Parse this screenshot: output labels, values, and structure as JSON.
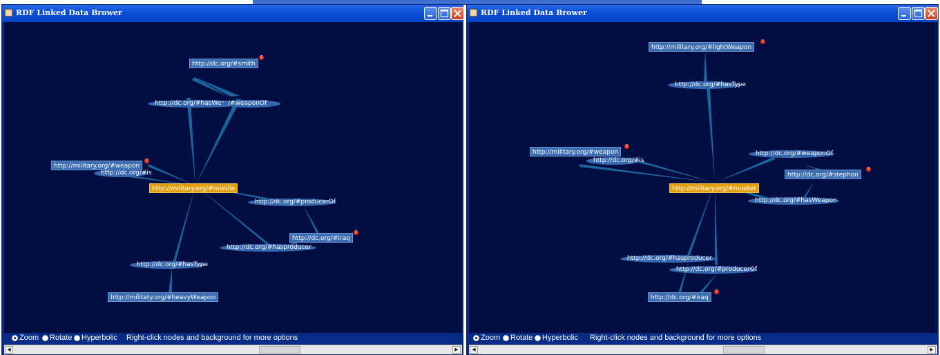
{
  "windows": [
    {
      "title": "RDF Linked Data Brower",
      "nodes": {
        "smith": "http://dc.org/#smith",
        "weapon": "http://military.org/#weapon",
        "is": "http://dc.org/#is",
        "missile": "http://military.org/#missile",
        "iraq": "http://dc.org/#iraq",
        "heavy_weapon": "http://militaty.org/#heavyWeapon",
        "has_weapon": "http://dc.org/#hasWeapon",
        "weapon_of": "/#weaponOf",
        "producer_of": "http://dc.org/#producerOf",
        "hasproducer": "http://dc.org/#hasproducer",
        "has_type": "http://dc.org/#hasType"
      },
      "badges": {
        "smith": "2",
        "weapon": "2",
        "iraq": "2"
      },
      "status": {
        "zoom": "Zoom",
        "rotate": "Rotate",
        "hyperbolic": "Hyperbolic",
        "hint": "Right-click nodes and background for more options",
        "selected": "zoom"
      }
    },
    {
      "title": "RDF Linked Data Brower",
      "nodes": {
        "light_weapon": "http://military.org/#lightWeapon",
        "has_type": "http://dc.org/#hasType",
        "weapon": "http://military.org/#weapon",
        "is": "http://dc.org/#is",
        "weapon_of": "http://dc.org/#weaponOf",
        "stephon": "http://dc.org/#stephon",
        "musket": "http://military.org/#musket",
        "has_weapon": "http://dc.org/#hasWeapon",
        "hasproducer": "http://dc.org/#hasproducer",
        "producer_of": "http://dc.org/#producerOf",
        "iraq": "http://dc.org/#iraq"
      },
      "badges": {
        "light_weapon": "1",
        "weapon": "2",
        "stephon": "2",
        "iraq": "2"
      },
      "status": {
        "zoom": "Zoom",
        "rotate": "Rotate",
        "hyperbolic": "Hyperbolic",
        "hint": "Right-click nodes and background for more options",
        "selected": "zoom"
      }
    }
  ],
  "colors": {
    "canvas": "#020d42",
    "node": "#3d6eb3",
    "focus_node": "#e4a012",
    "edge": "#1e6fa8",
    "badge": "#e62b1c",
    "titlebar": "#0a4fd6"
  },
  "icons": {
    "app": "java-cup-icon",
    "minimize": "minimize-icon",
    "maximize": "maximize-icon",
    "close": "close-icon"
  }
}
